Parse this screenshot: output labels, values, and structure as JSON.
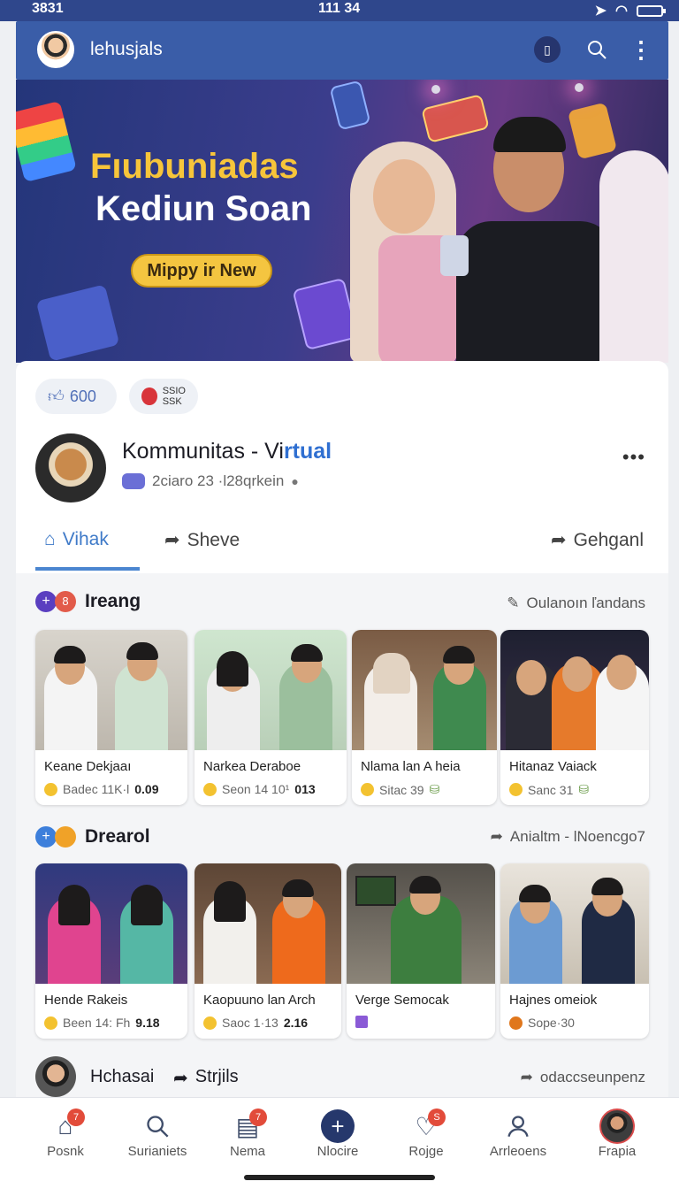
{
  "status": {
    "left": "3831",
    "time": "111 34"
  },
  "appbar": {
    "title": "lehusjals"
  },
  "hero": {
    "headline": "Fıubuniadas",
    "subheadline": "Kediun Soan",
    "cta": "Mippy ir New"
  },
  "post": {
    "like_count": "600",
    "badge_line1": "SSIO",
    "badge_line2": "SSK",
    "title_plain": "Kommunitas - Vi",
    "title_accent": "rtual",
    "meta": "2ciaro 23 ·l28qrkein"
  },
  "tabs": {
    "home": "Vihak",
    "share": "Sheve",
    "right": "Gehganl"
  },
  "section1": {
    "title": "Ireang",
    "badge": "8",
    "link": "Oulanoın ľandans",
    "tiles": [
      {
        "name": "Keane Dekjaaı",
        "stat": "Badec 11K·l",
        "value": "0.09"
      },
      {
        "name": "Narkea Deraboe",
        "stat": "Seon 14 10¹",
        "value": "013"
      },
      {
        "name": "Nlama lan A heia",
        "stat": "Sitac 39",
        "value": ""
      },
      {
        "name": "Hitanaz Vaiack",
        "stat": "Sanc 31",
        "value": ""
      }
    ]
  },
  "section2": {
    "title": "Drearol",
    "link": "Anialtm - lNoencgo7",
    "tiles": [
      {
        "name": "Hende Rakeis",
        "stat": "Been 14: Fh",
        "value": "9.18"
      },
      {
        "name": "Kaopuuno lan Arch",
        "stat": "Saoc 1·13",
        "value": "2.16"
      },
      {
        "name": "Verge Semocak",
        "stat": "",
        "value": ""
      },
      {
        "name": "Hajnes omeiok",
        "stat": "Sope·30",
        "value": ""
      }
    ]
  },
  "peek": {
    "name": "Hchasai",
    "share": "Strjils",
    "link": "odaccseunpenz"
  },
  "nav": [
    {
      "label": "Posnk",
      "icon": "home-icon",
      "badge": "7"
    },
    {
      "label": "Surianiets",
      "icon": "search-icon",
      "badge": ""
    },
    {
      "label": "Nema",
      "icon": "document-icon",
      "badge": "7"
    },
    {
      "label": "Nlocire",
      "icon": "plus-icon",
      "badge": ""
    },
    {
      "label": "Rojge",
      "icon": "heart-icon",
      "badge": "S"
    },
    {
      "label": "Arrleoens",
      "icon": "person-icon",
      "badge": ""
    },
    {
      "label": "Frapia",
      "icon": "avatar-icon",
      "badge": ""
    }
  ],
  "colors": {
    "appbar": "#3a5da8",
    "accent": "#2f6fd1",
    "cta": "#f4c540",
    "badge": "#e24b3a"
  }
}
